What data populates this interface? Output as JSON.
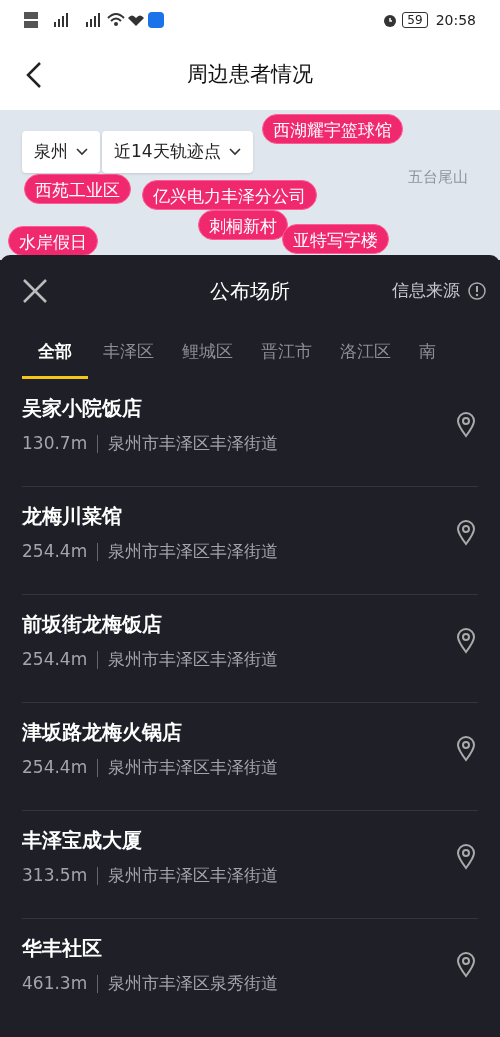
{
  "status_bar": {
    "time": "20:58",
    "battery": "59"
  },
  "header": {
    "title": "周边患者情况"
  },
  "map": {
    "filters": [
      {
        "label": "泉州"
      },
      {
        "label": "近14天轨迹点"
      }
    ],
    "places": [
      {
        "label": "西湖耀宇篮球馆",
        "kind": "pin"
      },
      {
        "label": "西苑工业区",
        "kind": "pin"
      },
      {
        "label": "亿兴电力丰泽分公司",
        "kind": "pin"
      },
      {
        "label": "水岸假日",
        "kind": "pin"
      },
      {
        "label": "刺桐新村",
        "kind": "pin"
      },
      {
        "label": "亚特写字楼",
        "kind": "pin"
      },
      {
        "label": "五台尾山",
        "kind": "area"
      }
    ]
  },
  "sheet": {
    "title": "公布场所",
    "source_link": "信息来源",
    "tabs": [
      {
        "label": "全部",
        "selected": true
      },
      {
        "label": "丰泽区",
        "selected": false
      },
      {
        "label": "鲤城区",
        "selected": false
      },
      {
        "label": "晋江市",
        "selected": false
      },
      {
        "label": "洛江区",
        "selected": false
      },
      {
        "label": "南",
        "selected": false
      }
    ],
    "places": [
      {
        "name": "吴家小院饭店",
        "distance": "130.7m",
        "address": "泉州市丰泽区丰泽街道"
      },
      {
        "name": "龙梅川菜馆",
        "distance": "254.4m",
        "address": "泉州市丰泽区丰泽街道"
      },
      {
        "name": "前坂街龙梅饭店",
        "distance": "254.4m",
        "address": "泉州市丰泽区丰泽街道"
      },
      {
        "name": "津坂路龙梅火锅店",
        "distance": "254.4m",
        "address": "泉州市丰泽区丰泽街道"
      },
      {
        "name": "丰泽宝成大厦",
        "distance": "313.5m",
        "address": "泉州市丰泽区丰泽街道"
      },
      {
        "name": "华丰社区",
        "distance": "461.3m",
        "address": "泉州市丰泽区泉秀街道"
      }
    ]
  }
}
